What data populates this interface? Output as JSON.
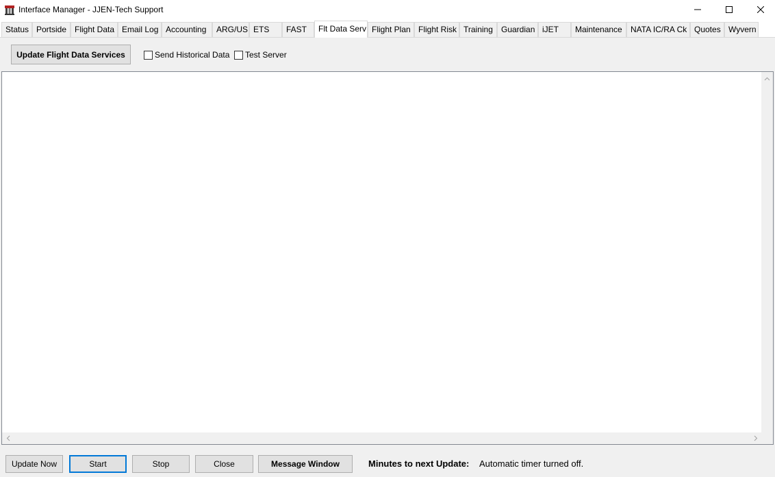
{
  "window": {
    "title": "Interface Manager - JJEN-Tech Support",
    "icon": "app-icon",
    "controls": {
      "minimize": "minimize-icon",
      "maximize": "maximize-icon",
      "close": "close-icon"
    }
  },
  "tabs": [
    {
      "label": "Status"
    },
    {
      "label": "Portside"
    },
    {
      "label": "Flight Data"
    },
    {
      "label": "Email Log"
    },
    {
      "label": "Accounting"
    },
    {
      "label": "ARG/US"
    },
    {
      "label": "ETS"
    },
    {
      "label": "FAST"
    },
    {
      "label": "Flt Data Serv",
      "active": true
    },
    {
      "label": "Flight Plan"
    },
    {
      "label": "Flight Risk"
    },
    {
      "label": "Training"
    },
    {
      "label": "Guardian"
    },
    {
      "label": "iJET"
    },
    {
      "label": "Maintenance"
    },
    {
      "label": "NATA IC/RA Ck"
    },
    {
      "label": "Quotes"
    },
    {
      "label": "Wyvern"
    }
  ],
  "page": {
    "update_button": "Update Flight Data Services",
    "send_historical": {
      "label": "Send Historical Data",
      "checked": false
    },
    "test_server": {
      "label": "Test Server",
      "checked": false
    },
    "log_text": ""
  },
  "bottom": {
    "update_now": "Update Now",
    "start": "Start",
    "stop": "Stop",
    "close": "Close",
    "message_window": "Message Window",
    "minutes_label": "Minutes to next Update:",
    "timer_status": "Automatic timer turned off."
  },
  "colors": {
    "focus": "#0078d7",
    "face": "#f0f0f0",
    "button": "#e1e1e1",
    "border": "#adadad"
  }
}
